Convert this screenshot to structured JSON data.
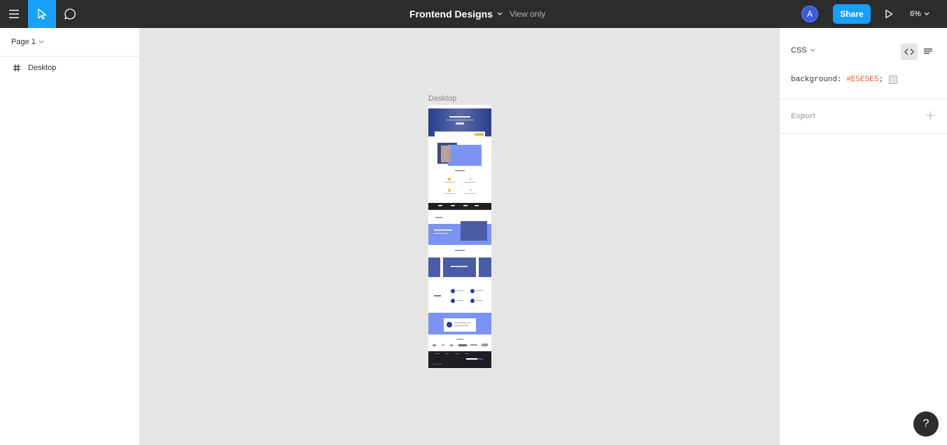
{
  "toolbar": {
    "title": "Frontend Designs",
    "view_only": "View only",
    "avatar_initial": "A",
    "share_label": "Share",
    "zoom": "6%",
    "menu_icon": "hamburger-menu-icon",
    "move_icon": "move-pointer-icon",
    "comment_icon": "comment-icon",
    "play_icon": "present-play-icon",
    "accent": "#18a0fb"
  },
  "left_panel": {
    "page_label": "Page 1",
    "layers": [
      {
        "label": "Desktop",
        "icon": "frame-hash-icon"
      }
    ]
  },
  "canvas": {
    "background": "#e5e5e5",
    "frame_label": "Desktop"
  },
  "right_panel": {
    "mode_label": "CSS",
    "code_property": "background:",
    "code_value": "#E5E5E5",
    "code_end": ";",
    "export_label": "Export"
  },
  "help_label": "?"
}
